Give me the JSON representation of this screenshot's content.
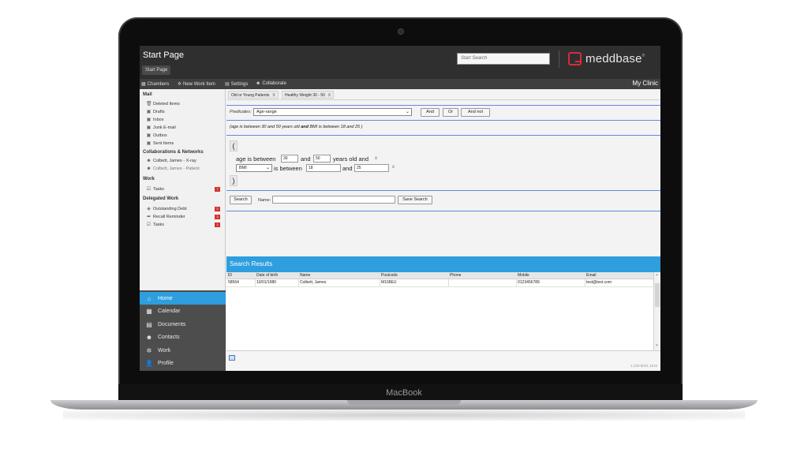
{
  "device": {
    "label": "MacBook"
  },
  "header": {
    "title": "Start Page",
    "breadcrumb": "Start Page",
    "search_placeholder": "Start Search",
    "logo_text": "meddbase",
    "logo_tm": "®"
  },
  "toolbar": {
    "items": [
      "Chambers",
      "New Work Item",
      "Settings",
      "Collaborate"
    ],
    "right": "My Clinic"
  },
  "sidebar": {
    "sections": {
      "mail": "Mail",
      "collab": "Collaborations & Networks",
      "work": "Work",
      "delegated": "Delegated Work"
    },
    "mail_items": [
      "Deleted Items",
      "Drafts",
      "Inbox",
      "Junk E-mail",
      "Outbox",
      "Sent Items"
    ],
    "collab_items": [
      "Colbett, James - X-ray",
      "Colbett, James - Patient"
    ],
    "work_items": [
      "Tasks"
    ],
    "delegated_items": [
      "Outstanding Debt",
      "Recall Reminder",
      "Tasks"
    ],
    "badges": [
      "7",
      "2",
      "3",
      "1"
    ]
  },
  "nav": {
    "items": [
      "Home",
      "Calendar",
      "Documents",
      "Contacts",
      "Work",
      "Profile"
    ]
  },
  "tabs": [
    "Old or Young Patients",
    "Healthy Weight 30 - 50"
  ],
  "tab_close": "X",
  "query": {
    "predicates_label": "Predicates:",
    "predicate_value": "Age-range",
    "btn_and": "And",
    "btn_or": "Or",
    "btn_andnot": "And not",
    "desc_pre": "(age is between 30 and 50 years old ",
    "desc_and": "and",
    "desc_post": " BMI is between 18 and 25 )",
    "open_paren": "(",
    "close_paren": ")",
    "age_text": "age is between",
    "and1": "and",
    "years_text": "years old and",
    "age_min": "30",
    "age_max": "50",
    "bmi_select": "BMI",
    "between_text": "is between",
    "and2": "and",
    "bmi_min": "18",
    "bmi_max": "25",
    "x": "x",
    "search_btn": "Search",
    "name_label": "Name:",
    "save_btn": "Save Search"
  },
  "results": {
    "title": "Search Results",
    "columns": [
      "ID",
      "Date of birth",
      "Name",
      "Postcode",
      "Phone",
      "Mobile",
      "Email"
    ],
    "rows": [
      [
        "58564",
        "10/01/1980",
        "Colbett, James",
        "M168EU",
        "",
        "0123456789",
        "test@test.com"
      ]
    ]
  },
  "version": "1.220.8031.1515"
}
